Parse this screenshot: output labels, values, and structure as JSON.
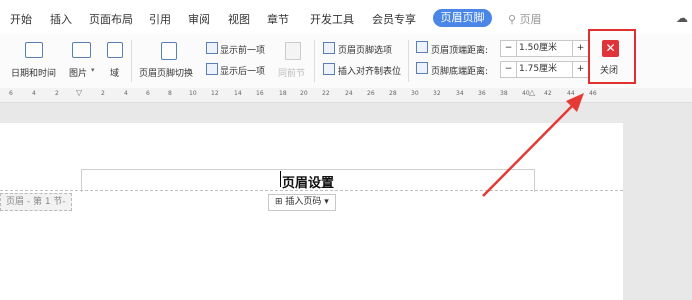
{
  "menu": {
    "items": [
      "开始",
      "插入",
      "页面布局",
      "引用",
      "审阅",
      "视图",
      "章节",
      "开发工具",
      "会员专享"
    ],
    "active_tab": "页眉页脚",
    "search_label": "页眉"
  },
  "toolbar": {
    "date_time": "日期和时间",
    "picture": "图片",
    "field": "域",
    "switch": "页眉页脚切换",
    "show_prev": "显示前一项",
    "show_next": "显示后一项",
    "same_as_prev": "同前节",
    "hf_options": "页眉页脚选项",
    "insert_align_tab": "插入对齐制表位",
    "top_distance_label": "页眉顶端距离:",
    "top_distance_value": "1.50厘米",
    "bottom_distance_label": "页脚底端距离:",
    "bottom_distance_value": "1.75厘米",
    "minus": "−",
    "plus": "+",
    "close": "关闭",
    "close_icon": "✕"
  },
  "ruler": {
    "ticks": [
      "6",
      "4",
      "2",
      "2",
      "4",
      "6",
      "8",
      "10",
      "12",
      "14",
      "16",
      "18",
      "20",
      "22",
      "24",
      "26",
      "28",
      "30",
      "32",
      "34",
      "36",
      "38",
      "40",
      "42",
      "44",
      "46"
    ]
  },
  "document": {
    "header_text": "页眉设置",
    "header_label": "页眉 - 第 1 节-",
    "insert_page_number": "插入页码"
  },
  "colors": {
    "accent": "#4a86e8",
    "highlight": "#e03030"
  }
}
